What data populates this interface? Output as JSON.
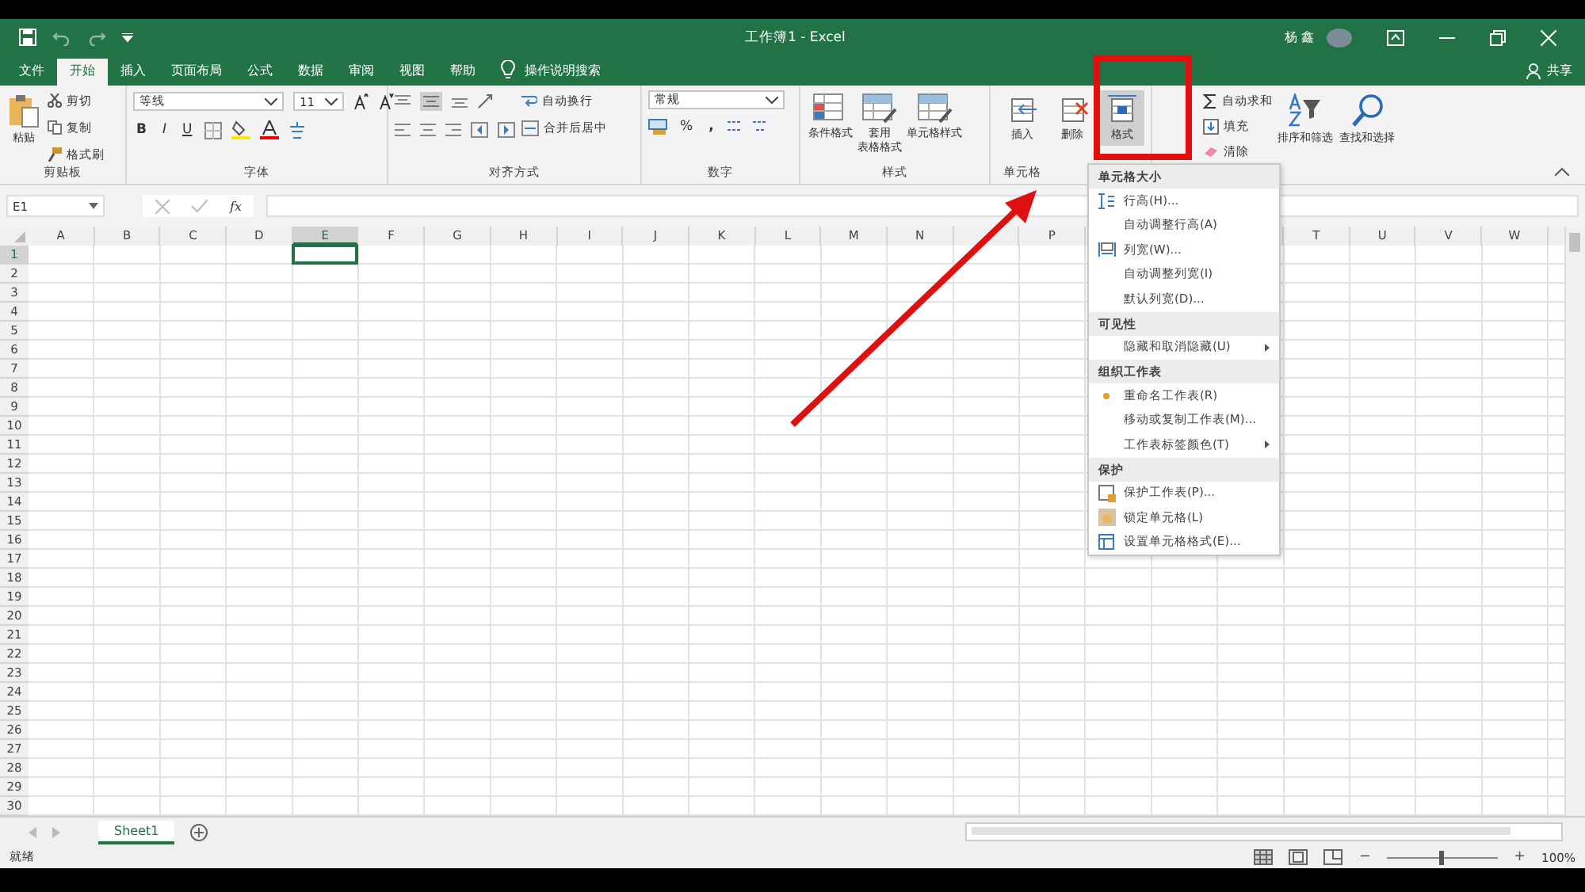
{
  "window": {
    "title": "工作簿1 - Excel",
    "user": "杨 鑫"
  },
  "tabs": [
    {
      "label": "文件",
      "selected": false
    },
    {
      "label": "开始",
      "selected": true
    },
    {
      "label": "插入",
      "selected": false
    },
    {
      "label": "页面布局",
      "selected": false
    },
    {
      "label": "公式",
      "selected": false
    },
    {
      "label": "数据",
      "selected": false
    },
    {
      "label": "审阅",
      "selected": false
    },
    {
      "label": "视图",
      "selected": false
    },
    {
      "label": "帮助",
      "selected": false
    }
  ],
  "tell_me": "操作说明搜索",
  "share": "共享",
  "ribbon": {
    "clipboard": {
      "label": "剪贴板",
      "paste": "粘贴",
      "cut": "剪切",
      "copy": "复制",
      "painter": "格式刷"
    },
    "font": {
      "label": "字体",
      "name": "等线",
      "size": "11",
      "bold": "B",
      "italic": "I",
      "underline": "U"
    },
    "alignment": {
      "label": "对齐方式",
      "wrap": "自动换行",
      "merge": "合并后居中"
    },
    "number": {
      "label": "数字",
      "format": "常规",
      "percent": "%",
      "comma": ","
    },
    "styles": {
      "label": "样式",
      "buttons": [
        {
          "lines": [
            "条件格式"
          ]
        },
        {
          "lines": [
            "套用",
            "表格格式"
          ]
        },
        {
          "lines": [
            "单元格样式"
          ]
        }
      ]
    },
    "cells": {
      "label": "单元格",
      "buttons": [
        {
          "label": "插入",
          "pressed": false
        },
        {
          "label": "删除",
          "pressed": false
        },
        {
          "label": "格式",
          "pressed": true
        }
      ]
    },
    "editing": {
      "sum": "自动求和",
      "fill": "填充",
      "clear": "清除",
      "sort": "排序和筛选",
      "find": "查找和选择"
    }
  },
  "formula_bar": {
    "name_box": "E1",
    "fx": "fx"
  },
  "columns": [
    {
      "label": "A",
      "selected": false
    },
    {
      "label": "B",
      "selected": false
    },
    {
      "label": "C",
      "selected": false
    },
    {
      "label": "D",
      "selected": false
    },
    {
      "label": "E",
      "selected": true
    },
    {
      "label": "F",
      "selected": false
    },
    {
      "label": "G",
      "selected": false
    },
    {
      "label": "H",
      "selected": false
    },
    {
      "label": "I",
      "selected": false
    },
    {
      "label": "J",
      "selected": false
    },
    {
      "label": "K",
      "selected": false
    },
    {
      "label": "L",
      "selected": false
    },
    {
      "label": "M",
      "selected": false
    },
    {
      "label": "N",
      "selected": false
    },
    {},
    {
      "label": "P",
      "selected": false
    },
    {},
    {},
    {},
    {
      "label": "T",
      "selected": false
    },
    {
      "label": "U",
      "selected": false
    },
    {
      "label": "V",
      "selected": false
    },
    {
      "label": "W",
      "selected": false
    }
  ],
  "rows": [
    {
      "label": "1",
      "selected": true
    },
    {
      "label": "2",
      "selected": false
    },
    {
      "label": "3",
      "selected": false
    },
    {
      "label": "4",
      "selected": false
    },
    {
      "label": "5",
      "selected": false
    },
    {
      "label": "6",
      "selected": false
    },
    {
      "label": "7",
      "selected": false
    },
    {
      "label": "8",
      "selected": false
    },
    {
      "label": "9",
      "selected": false
    },
    {
      "label": "10",
      "selected": false
    },
    {
      "label": "11",
      "selected": false
    },
    {
      "label": "12",
      "selected": false
    },
    {
      "label": "13",
      "selected": false
    },
    {
      "label": "14",
      "selected": false
    },
    {
      "label": "15",
      "selected": false
    },
    {
      "label": "16",
      "selected": false
    },
    {
      "label": "17",
      "selected": false
    },
    {
      "label": "18",
      "selected": false
    },
    {
      "label": "19",
      "selected": false
    },
    {
      "label": "20",
      "selected": false
    },
    {
      "label": "21",
      "selected": false
    },
    {
      "label": "22",
      "selected": false
    },
    {
      "label": "23",
      "selected": false
    },
    {
      "label": "24",
      "selected": false
    },
    {
      "label": "25",
      "selected": false
    },
    {
      "label": "26",
      "selected": false
    },
    {
      "label": "27",
      "selected": false
    },
    {
      "label": "28",
      "selected": false
    },
    {
      "label": "29",
      "selected": false
    },
    {
      "label": "30",
      "selected": false
    }
  ],
  "menu": [
    {
      "kind": "header",
      "label": "单元格大小"
    },
    {
      "kind": "item",
      "label": "行高(H)...",
      "submenu": false
    },
    {
      "kind": "item",
      "label": "自动调整行高(A)",
      "submenu": false
    },
    {
      "kind": "item",
      "label": "列宽(W)...",
      "submenu": false
    },
    {
      "kind": "item",
      "label": "自动调整列宽(I)",
      "submenu": false
    },
    {
      "kind": "item",
      "label": "默认列宽(D)...",
      "submenu": false
    },
    {
      "kind": "header",
      "label": "可见性"
    },
    {
      "kind": "item",
      "label": "隐藏和取消隐藏(U)",
      "submenu": true
    },
    {
      "kind": "header",
      "label": "组织工作表"
    },
    {
      "kind": "item",
      "label": "重命名工作表(R)",
      "submenu": false
    },
    {
      "kind": "item",
      "label": "移动或复制工作表(M)...",
      "submenu": false
    },
    {
      "kind": "item",
      "label": "工作表标签颜色(T)",
      "submenu": true
    },
    {
      "kind": "header",
      "label": "保护"
    },
    {
      "kind": "item",
      "label": "保护工作表(P)...",
      "submenu": false
    },
    {
      "kind": "item",
      "label": "锁定单元格(L)",
      "submenu": false
    },
    {
      "kind": "item",
      "label": "设置单元格格式(E)...",
      "submenu": false
    }
  ],
  "sheets": [
    {
      "label": "Sheet1",
      "selected": true
    }
  ],
  "status": {
    "text": "就绪",
    "zoom_out": "−",
    "zoom_in": "+",
    "zoom": "100%",
    "level": 0.5
  }
}
